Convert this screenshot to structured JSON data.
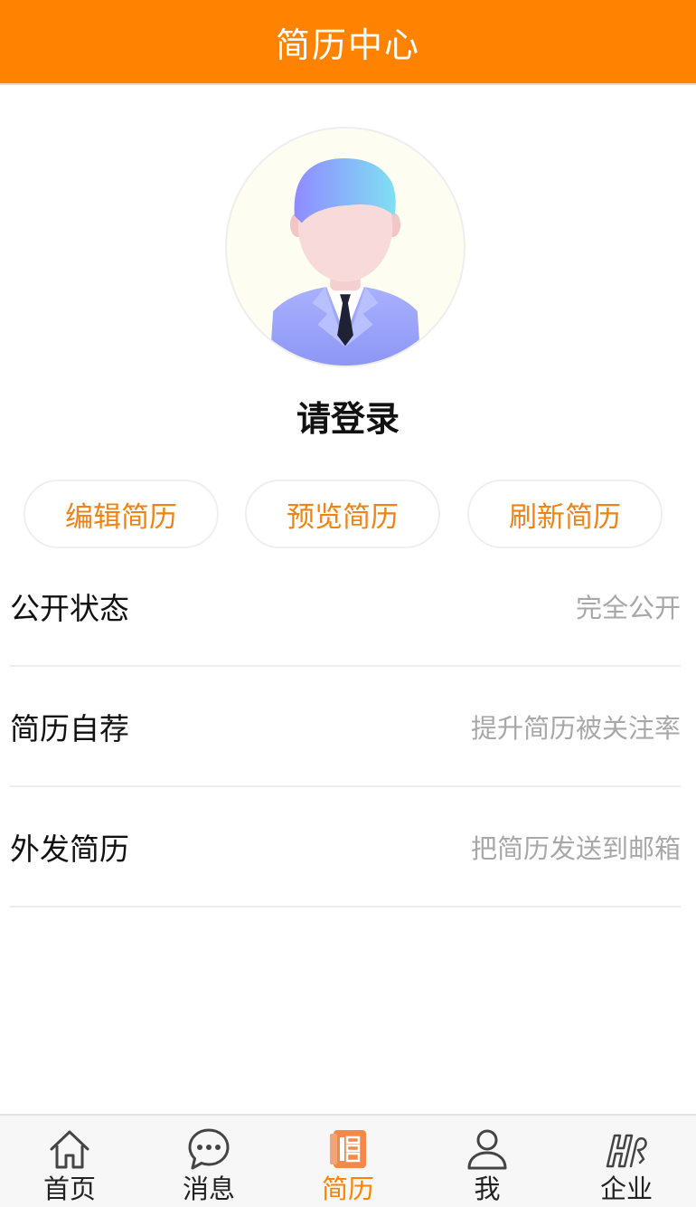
{
  "header": {
    "title": "简历中心"
  },
  "profile": {
    "name": "请登录"
  },
  "actions": {
    "edit": "编辑简历",
    "preview": "预览简历",
    "refresh": "刷新简历"
  },
  "settings": [
    {
      "label": "公开状态",
      "value": "完全公开"
    },
    {
      "label": "简历自荐",
      "value": "提升简历被关注率"
    },
    {
      "label": "外发简历",
      "value": "把简历发送到邮箱"
    }
  ],
  "tabbar": {
    "active": "简历",
    "items": [
      {
        "label": "首页",
        "icon": "home-icon"
      },
      {
        "label": "消息",
        "icon": "chat-icon"
      },
      {
        "label": "简历",
        "icon": "resume-icon"
      },
      {
        "label": "我",
        "icon": "user-icon"
      },
      {
        "label": "企业",
        "icon": "company-icon"
      }
    ]
  },
  "colors": {
    "brand": "#ff8200",
    "action_text": "#f08313",
    "muted_text": "#a8a8a8"
  }
}
